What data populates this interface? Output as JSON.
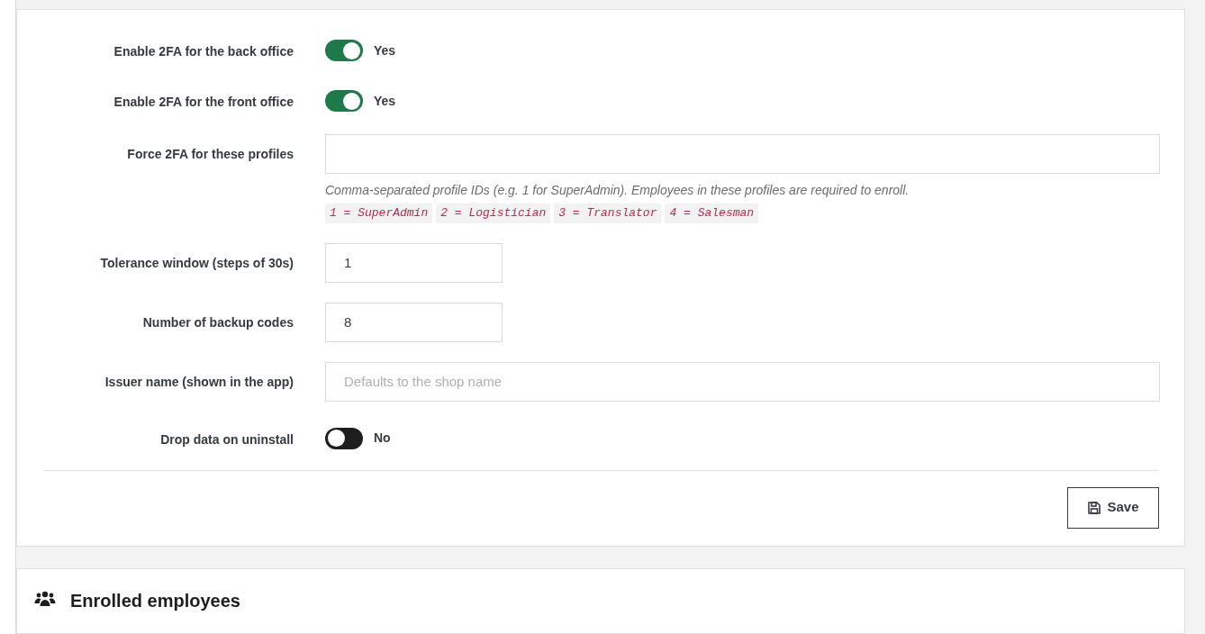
{
  "settings": {
    "fields": [
      {
        "kind": "switch",
        "label": "Enable 2FA for the back office",
        "on": true,
        "state_label": "Yes"
      },
      {
        "kind": "switch",
        "label": "Enable 2FA for the front office",
        "on": true,
        "state_label": "Yes"
      },
      {
        "kind": "text",
        "label": "Force 2FA for these profiles",
        "help": "Comma-separated profile IDs (e.g. 1 for SuperAdmin). Employees in these profiles are required to enroll.",
        "codes": [
          "1 = SuperAdmin",
          "2 = Logistician",
          "3 = Translator",
          "4 = Salesman"
        ]
      },
      {
        "kind": "number",
        "label": "Tolerance window (steps of 30s)",
        "value": "1"
      },
      {
        "kind": "number",
        "label": "Number of backup codes",
        "value": "8"
      },
      {
        "kind": "text",
        "label": "Issuer name (shown in the app)",
        "placeholder": "Defaults to the shop name"
      },
      {
        "kind": "switch",
        "label": "Drop data on uninstall",
        "on": false,
        "state_label": "No"
      }
    ],
    "save_button": "Save"
  },
  "enrolled": {
    "title": "Enrolled employees"
  }
}
